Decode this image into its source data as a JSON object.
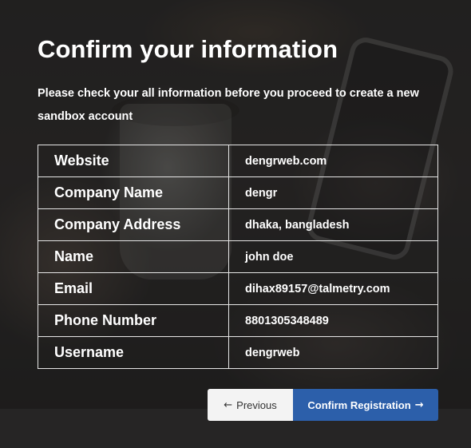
{
  "page": {
    "title": "Confirm your information",
    "subtitle": "Please check your all information before you proceed to create a new sandbox account"
  },
  "info_rows": [
    {
      "label": "Website",
      "value": "dengrweb.com"
    },
    {
      "label": "Company Name",
      "value": "dengr"
    },
    {
      "label": "Company Address",
      "value": "dhaka, bangladesh"
    },
    {
      "label": "Name",
      "value": "john doe"
    },
    {
      "label": "Email",
      "value": "dihax89157@talmetry.com"
    },
    {
      "label": "Phone Number",
      "value": "8801305348489"
    },
    {
      "label": "Username",
      "value": "dengrweb"
    }
  ],
  "actions": {
    "previous_label": "Previous",
    "previous_icon": "arrow-left-icon",
    "confirm_label": "Confirm Registration",
    "confirm_icon": "arrow-right-icon"
  },
  "colors": {
    "confirm_button": "#2c5faa",
    "previous_button": "#f3f3f3",
    "table_border": "#e6e6e6",
    "text": "#ffffff"
  }
}
